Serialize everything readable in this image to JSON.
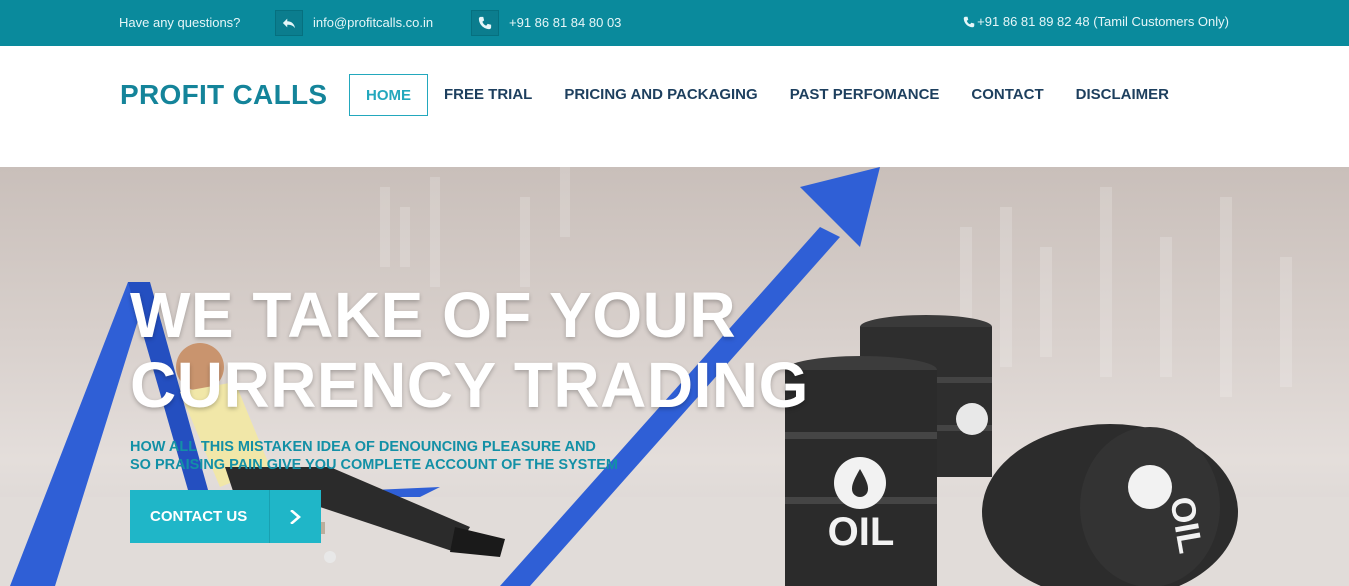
{
  "topbar": {
    "question": "Have any questions?",
    "email": "info@profitcalls.co.in",
    "phone": "+91 86 81 84 80 03",
    "tamil_phone": "+91 86 81 89 82 48 (Tamil Customers Only)",
    "icons": {
      "email": "reply-arrow-icon",
      "phone": "phone-icon",
      "tamil": "phone-icon"
    }
  },
  "header": {
    "logo": "PROFIT CALLS",
    "nav": [
      {
        "label": "HOME",
        "active": true
      },
      {
        "label": "FREE TRIAL",
        "active": false
      },
      {
        "label": "PRICING AND PACKAGING",
        "active": false
      },
      {
        "label": "PAST PERFOMANCE",
        "active": false
      },
      {
        "label": "CONTACT",
        "active": false
      },
      {
        "label": "DISCLAIMER",
        "active": false
      }
    ]
  },
  "hero": {
    "title_line1": "WE TAKE OF YOUR",
    "title_line2": "CURRENCY TRADING",
    "sub_line1": "HOW ALL THIS MISTAKEN IDEA OF DENOUNCING PLEASURE AND",
    "sub_line2": "SO PRAISING PAIN GIVE YOU COMPLETE ACCOUNT OF THE SYSTEM",
    "cta_label": "CONTACT US",
    "barrel_label": "OIL",
    "barrel_label_rotated": "OIL"
  },
  "colors": {
    "topbar": "#0a8a9c",
    "brand": "#14849a",
    "accent": "#1fb6c8",
    "nav_text": "#1d3f5e",
    "arrow_blue": "#2f5fd6"
  }
}
